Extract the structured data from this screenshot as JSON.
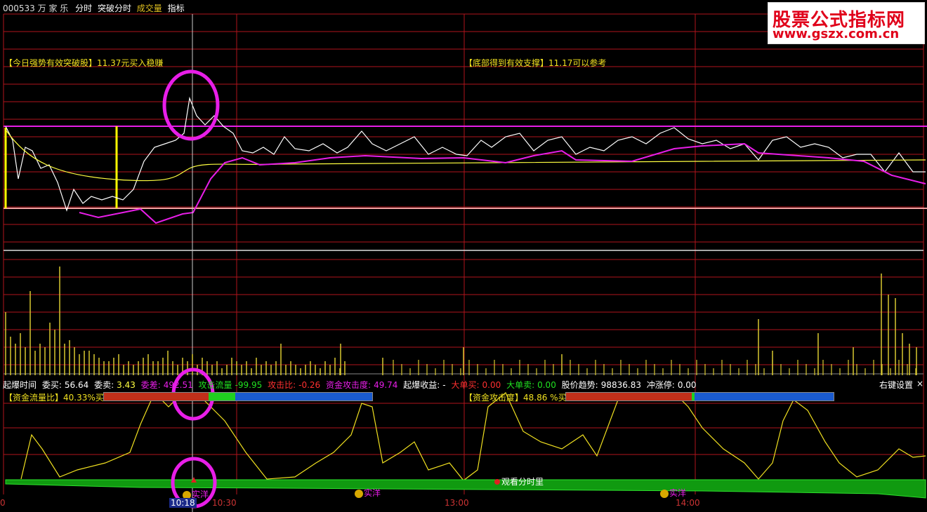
{
  "header": {
    "stock_code_name": "000533 万 家 乐",
    "tabs": [
      "分时",
      "突破分时",
      "成交量",
      "指标"
    ]
  },
  "watermark": {
    "line1": "股票公式指标网",
    "line2": "www.gszx.com.cn"
  },
  "annotations": {
    "left": "【今日强势有效突破股】11.37元买入稳赚",
    "right": "【底部得到有效支撑】11.17可以参考"
  },
  "stats": {
    "items": [
      {
        "label": "起爆时间",
        "value": ""
      },
      {
        "label": "委买:",
        "value": "56.64"
      },
      {
        "label": "委卖:",
        "value": "3.43"
      },
      {
        "label": "委差:",
        "value": "492.51"
      },
      {
        "label": "攻击流量",
        "value": "-99.95"
      },
      {
        "label": "攻击比:",
        "value": "-0.26"
      },
      {
        "label": "资金攻击度:",
        "value": "49.74"
      },
      {
        "label": "起爆收益:",
        "value": "-"
      },
      {
        "label": "大单买:",
        "value": "0.00"
      },
      {
        "label": "大单卖:",
        "value": "0.00"
      },
      {
        "label": "股价趋势:",
        "value": "98836.83"
      },
      {
        "label": "冲涨停:",
        "value": "0.00"
      }
    ],
    "settings": "右键设置",
    "close": "×"
  },
  "indicators": {
    "left_label": "【资金流量比】40.33%买",
    "right_label": "【资金攻击度】48.86 %买",
    "left_bar": {
      "red": 0.39,
      "green": 0.1,
      "blue": 0.51
    },
    "right_bar": {
      "red": 0.47,
      "green": 0.01,
      "blue": 0.52
    }
  },
  "markers": {
    "cash1": "实洋",
    "cash2": "实洋",
    "cash3": "实洋",
    "center": "观看分时里"
  },
  "time_axis": {
    "start": "0",
    "cursor": "10:18",
    "t1": "10:30",
    "t2": "13:00",
    "t3": "14:00"
  },
  "colors": {
    "grid": "#b0141c",
    "price": "#ffffff",
    "avg": "#ffff40",
    "magenta": "#e81ee8",
    "yellow": "#f0e020",
    "green": "#109a10"
  }
}
